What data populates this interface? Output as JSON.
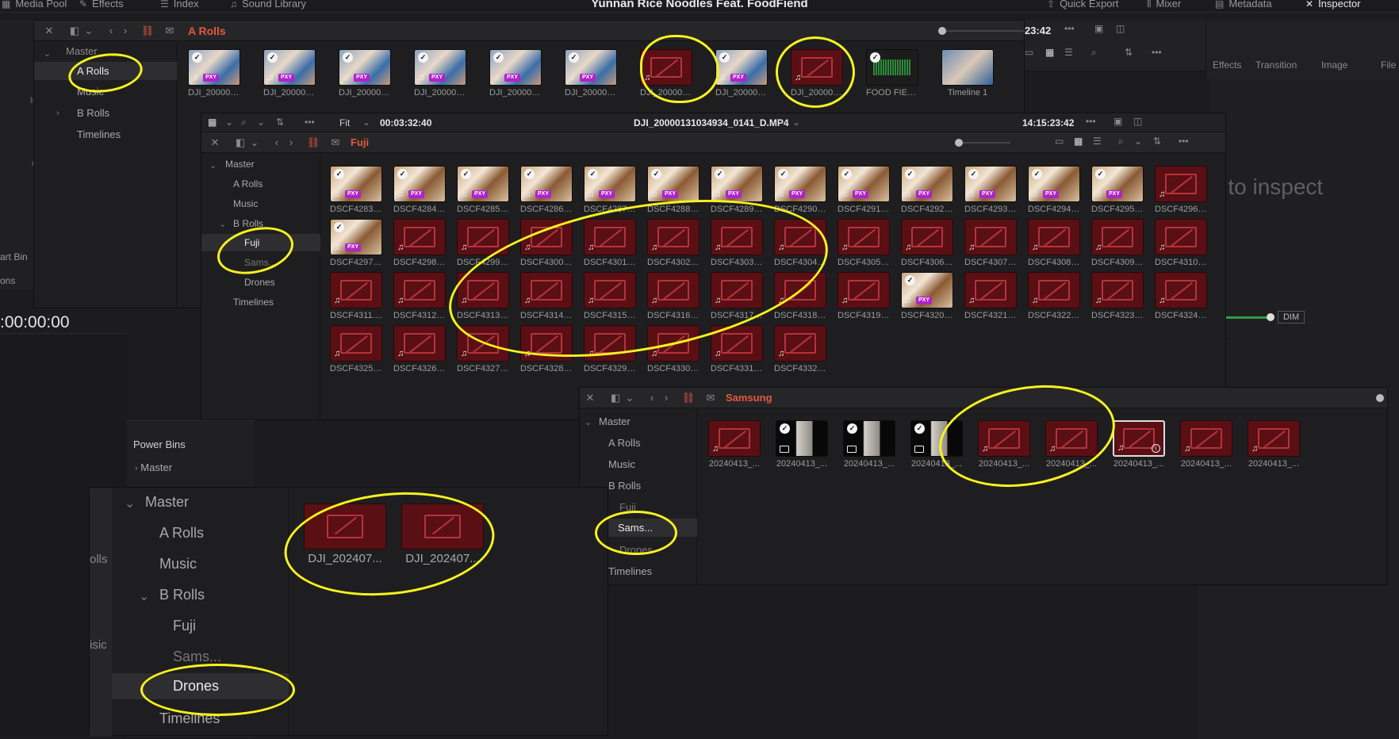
{
  "topbar": {
    "project_title": "Yunnan Rice Noodles Feat. FoodFiend",
    "items": [
      "Media Pool",
      "Effects",
      "Index",
      "Sound Library"
    ],
    "right_items": [
      "Quick Export",
      "Mixer",
      "Metadata",
      "Inspector"
    ],
    "timecode": "23:42"
  },
  "inspector_bg": {
    "effects_tabs": [
      "Effects",
      "Transition",
      "Image",
      "File"
    ],
    "placeholder": "g to inspect",
    "dim": "DIM"
  },
  "background": {
    "timecode": ":00:00:00",
    "power_bins": "Power Bins",
    "master": "Master",
    "frags": [
      "ls",
      "c",
      "art Bin",
      "ons",
      "olls",
      "isic"
    ]
  },
  "arolls_panel": {
    "bin": "A Rolls",
    "tree": [
      "Master",
      "A Rolls",
      "Music",
      "B Rolls",
      "Timelines"
    ],
    "clips": [
      {
        "label": "DJI_200001...",
        "kind": "people"
      },
      {
        "label": "DJI_200001...",
        "kind": "people"
      },
      {
        "label": "DJI_200001...",
        "kind": "people"
      },
      {
        "label": "DJI_200001...",
        "kind": "people"
      },
      {
        "label": "DJI_200001...",
        "kind": "people"
      },
      {
        "label": "DJI_200001...",
        "kind": "people"
      },
      {
        "label": "DJI_200001...",
        "kind": "off"
      },
      {
        "label": "DJI_200001...",
        "kind": "people"
      },
      {
        "label": "DJI_200001...",
        "kind": "off"
      },
      {
        "label": "FOOD FIEN...",
        "kind": "audio"
      },
      {
        "label": "Timeline 1",
        "kind": "tl"
      }
    ]
  },
  "fuji_panel": {
    "bin": "Fuji",
    "viewer_tc": "00:03:32:40",
    "fit": "Fit",
    "clip_name": "DJI_20000131034934_0141_D.MP4",
    "record_tc": "14:15:23:42",
    "tree": [
      "Master",
      "A Rolls",
      "Music",
      "B Rolls",
      "Fuji",
      "Sams...",
      "Drones",
      "Timelines"
    ],
    "clips": [
      "DSCF4283....",
      "DSCF4284....",
      "DSCF4285....",
      "DSCF4286....",
      "DSCF4287....",
      "DSCF4288....",
      "DSCF4289....",
      "DSCF4290....",
      "DSCF4291....",
      "DSCF4292....",
      "DSCF4293....",
      "DSCF4294....",
      "DSCF4295....",
      "DSCF4296....",
      "DSCF4297....",
      "DSCF4298....",
      "DSCF4299....",
      "DSCF4300....",
      "DSCF4301....",
      "DSCF4302....",
      "DSCF4303....",
      "DSCF4304....",
      "DSCF4305....",
      "DSCF4306....",
      "DSCF4307....",
      "DSCF4308....",
      "DSCF4309....",
      "DSCF4310....",
      "DSCF4311....",
      "DSCF4312....",
      "DSCF4313....",
      "DSCF4314....",
      "DSCF4315....",
      "DSCF4316....",
      "DSCF4317....",
      "DSCF4318....",
      "DSCF4319....",
      "DSCF4320....",
      "DSCF4321....",
      "DSCF4322....",
      "DSCF4323....",
      "DSCF4324....",
      "DSCF4325....",
      "DSCF4326....",
      "DSCF4327....",
      "DSCF4328....",
      "DSCF4329....",
      "DSCF4330....",
      "DSCF4331....",
      "DSCF4332...."
    ],
    "food_indices": [
      0,
      1,
      2,
      3,
      4,
      5,
      6,
      7,
      8,
      9,
      10,
      11,
      12,
      14,
      37
    ]
  },
  "samsung_panel": {
    "bin": "Samsung",
    "tree": [
      "Master",
      "A Rolls",
      "Music",
      "B Rolls",
      "Fuji",
      "Sams...",
      "Drones",
      "Timelines"
    ],
    "clips": [
      {
        "label": "20240413_...",
        "kind": "off"
      },
      {
        "label": "20240413_...",
        "kind": "bw"
      },
      {
        "label": "20240413_...",
        "kind": "bw"
      },
      {
        "label": "20240413_...",
        "kind": "bw"
      },
      {
        "label": "20240413_...",
        "kind": "off"
      },
      {
        "label": "20240413_...",
        "kind": "off"
      },
      {
        "label": "20240413_...",
        "kind": "off-info"
      },
      {
        "label": "20240413_...",
        "kind": "off"
      },
      {
        "label": "20240413_...",
        "kind": "off"
      }
    ]
  },
  "drones_panel": {
    "tree": [
      "Master",
      "A Rolls",
      "Music",
      "B Rolls",
      "Fuji",
      "Sams...",
      "Drones",
      "Timelines"
    ],
    "clips": [
      "DJI_202407...",
      "DJI_202407..."
    ]
  },
  "colors": {
    "accent": "#e4593f",
    "annotation": "#f7f21f",
    "offline": "#5a0f14"
  }
}
